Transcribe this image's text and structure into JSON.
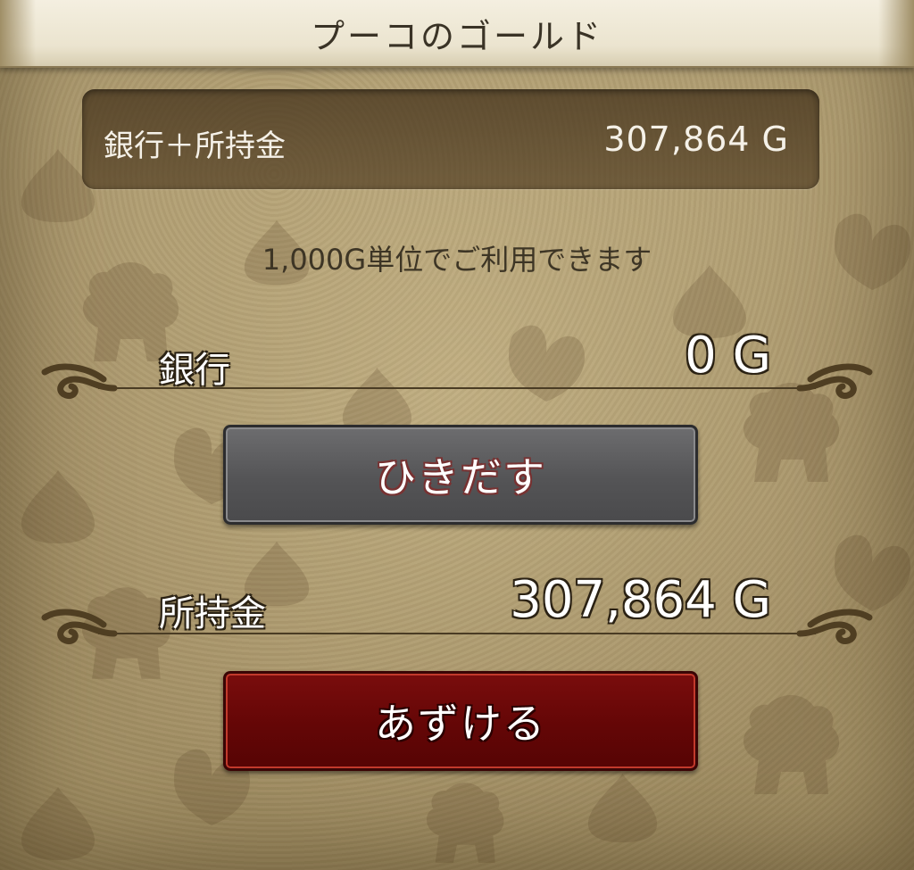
{
  "header": {
    "title": "プーコのゴールド"
  },
  "total": {
    "label": "銀行＋所持金",
    "value": "307,864 G"
  },
  "note": "1,000G単位でご利用できます",
  "bank": {
    "label": "銀行",
    "value": "0 G"
  },
  "wallet": {
    "label": "所持金",
    "value": "307,864 G"
  },
  "buttons": {
    "withdraw": "ひきだす",
    "deposit": "あずける"
  },
  "colors": {
    "withdraw_button": "#545456",
    "deposit_button": "#640606",
    "header_bg": "#ebe4cf",
    "parchment": "#a8956a"
  }
}
